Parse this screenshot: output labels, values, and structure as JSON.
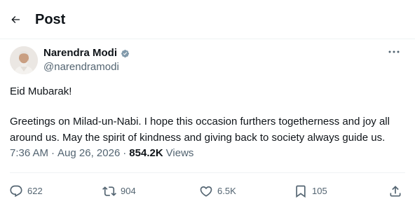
{
  "header": {
    "title": "Post"
  },
  "author": {
    "name": "Narendra Modi",
    "handle": "@narendramodi"
  },
  "post": {
    "line1": "Eid Mubarak!",
    "line2": "Greetings on Milad-un-Nabi. I hope this occasion furthers togetherness and joy all around us. May the spirit of kindness and giving back to society always guide us."
  },
  "meta": {
    "time": "7:36 AM",
    "separator": "·",
    "date": "Aug 26, 2026",
    "views_count": "854.2K",
    "views_label": "Views"
  },
  "actions": {
    "replies": "622",
    "reposts": "904",
    "likes": "6.5K",
    "bookmarks": "105"
  },
  "icons": {
    "back": "back-arrow-icon",
    "verified": "verified-badge-icon",
    "more": "more-horizontal-icon",
    "reply": "reply-icon",
    "repost": "repost-icon",
    "like": "heart-icon",
    "bookmark": "bookmark-icon",
    "share": "share-icon"
  },
  "colors": {
    "text": "#0f1419",
    "secondary": "#536471",
    "verified": "#829aab",
    "divider": "#eff3f4"
  }
}
